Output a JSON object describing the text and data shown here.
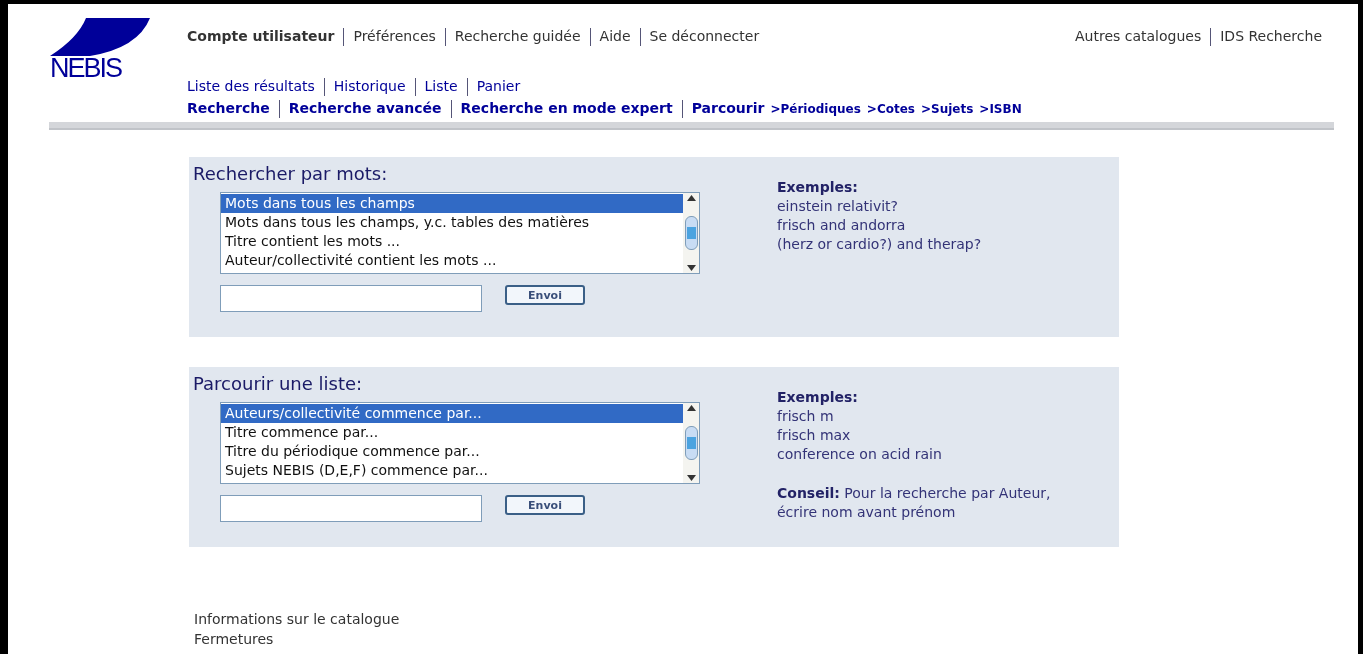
{
  "logo": {
    "text": "NEBIS"
  },
  "top_nav": [
    {
      "label": "Compte utilisateur",
      "selected": true
    },
    {
      "label": "Préférences",
      "selected": false
    },
    {
      "label": "Recherche guidée",
      "selected": false
    },
    {
      "label": "Aide",
      "selected": false
    },
    {
      "label": "Se déconnecter",
      "selected": false
    }
  ],
  "right_nav": [
    "Autres catalogues",
    "IDS Recherche"
  ],
  "secondary_nav": [
    "Liste des résultats",
    "Historique",
    "Liste",
    "Panier"
  ],
  "search_nav": [
    {
      "label": "Recherche",
      "kind": "link"
    },
    {
      "label": "Recherche avancée",
      "kind": "link"
    },
    {
      "label": "Recherche en mode expert",
      "kind": "link"
    },
    {
      "label": "Parcourir",
      "kind": "link"
    },
    {
      "label": ">Périodiques",
      "kind": "sublink"
    },
    {
      "label": ">Cotes",
      "kind": "sublink"
    },
    {
      "label": ">Sujets",
      "kind": "sublink"
    },
    {
      "label": ">ISBN",
      "kind": "sublink"
    }
  ],
  "panels": [
    {
      "title": "Rechercher par mots:",
      "options": [
        {
          "label": "Mots dans tous les champs",
          "selected": true
        },
        {
          "label": "Mots dans tous les champs, y.c. tables des matières",
          "selected": false
        },
        {
          "label": "Titre contient les mots ...",
          "selected": false
        },
        {
          "label": "Auteur/collectivité contient les mots ...",
          "selected": false
        }
      ],
      "button": "Envoi",
      "examples_title": "Exemples:",
      "examples": [
        "einstein relativit?",
        "frisch and andorra",
        "(herz or cardio?) and therap?"
      ]
    },
    {
      "title": "Parcourir une liste:",
      "options": [
        {
          "label": "Auteurs/collectivité commence par...",
          "selected": true
        },
        {
          "label": "Titre commence par...",
          "selected": false
        },
        {
          "label": "Titre du périodique commence par...",
          "selected": false
        },
        {
          "label": "Sujets NEBIS (D,E,F) commence par...",
          "selected": false
        }
      ],
      "button": "Envoi",
      "examples_title": "Exemples:",
      "examples": [
        "frisch m",
        "frisch max",
        "conference on acid rain"
      ],
      "tip": "**Conseil:** Pour la recherche par Auteur, écrire nom avant prénom"
    }
  ],
  "footer_links": [
    "Informations sur le catalogue",
    "Fermetures"
  ]
}
